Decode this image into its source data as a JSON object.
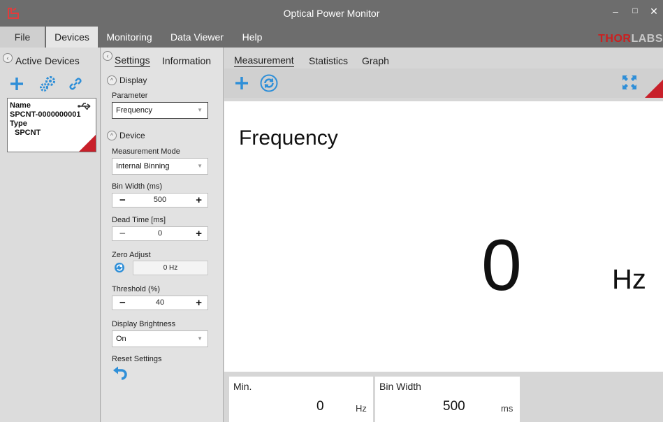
{
  "window": {
    "title": "Optical Power Monitor",
    "minimize_glyph": "–",
    "maximize_glyph": "□",
    "close_glyph": "✕"
  },
  "menu": {
    "file": "File",
    "devices": "Devices",
    "monitoring": "Monitoring",
    "data_viewer": "Data Viewer",
    "help": "Help"
  },
  "brand": {
    "part_a": "THOR",
    "part_b": "LABS"
  },
  "devices_panel": {
    "title": "Active Devices",
    "device": {
      "name_label": "Name",
      "name_value": "SPCNT-0000000001",
      "type_label": "Type",
      "type_value": "SPCNT"
    }
  },
  "settings_panel": {
    "tab_settings": "Settings",
    "tab_information": "Information",
    "display_section": "Display",
    "parameter_label": "Parameter",
    "parameter_value": "Frequency",
    "device_section": "Device",
    "measurement_mode_label": "Measurement Mode",
    "measurement_mode_value": "Internal Binning",
    "bin_width_label": "Bin Width (ms)",
    "bin_width_value": "500",
    "dead_time_label": "Dead Time [ms]",
    "dead_time_value": "0",
    "zero_adjust_label": "Zero Adjust",
    "zero_adjust_value": "0 Hz",
    "threshold_label": "Threshold (%)",
    "threshold_value": "40",
    "display_brightness_label": "Display Brightness",
    "display_brightness_value": "On",
    "reset_label": "Reset Settings"
  },
  "main_panel": {
    "tab_measurement": "Measurement",
    "tab_statistics": "Statistics",
    "tab_graph": "Graph",
    "measurement_title": "Frequency",
    "measurement_value": "0",
    "measurement_unit": "Hz",
    "stats": [
      {
        "label": "Min.",
        "value": "0",
        "unit": "Hz"
      },
      {
        "label": "Bin Width",
        "value": "500",
        "unit": "ms"
      }
    ]
  },
  "colors": {
    "accent_blue": "#2f8fd8",
    "corner_red": "#c8202a",
    "titlebar": "#6d6d6d"
  },
  "icons": [
    "app-icon",
    "add-icon",
    "device-settings-icon",
    "link-icon",
    "usb-icon",
    "refresh-icon",
    "expand-icon",
    "undo-icon",
    "collapse-icon"
  ]
}
